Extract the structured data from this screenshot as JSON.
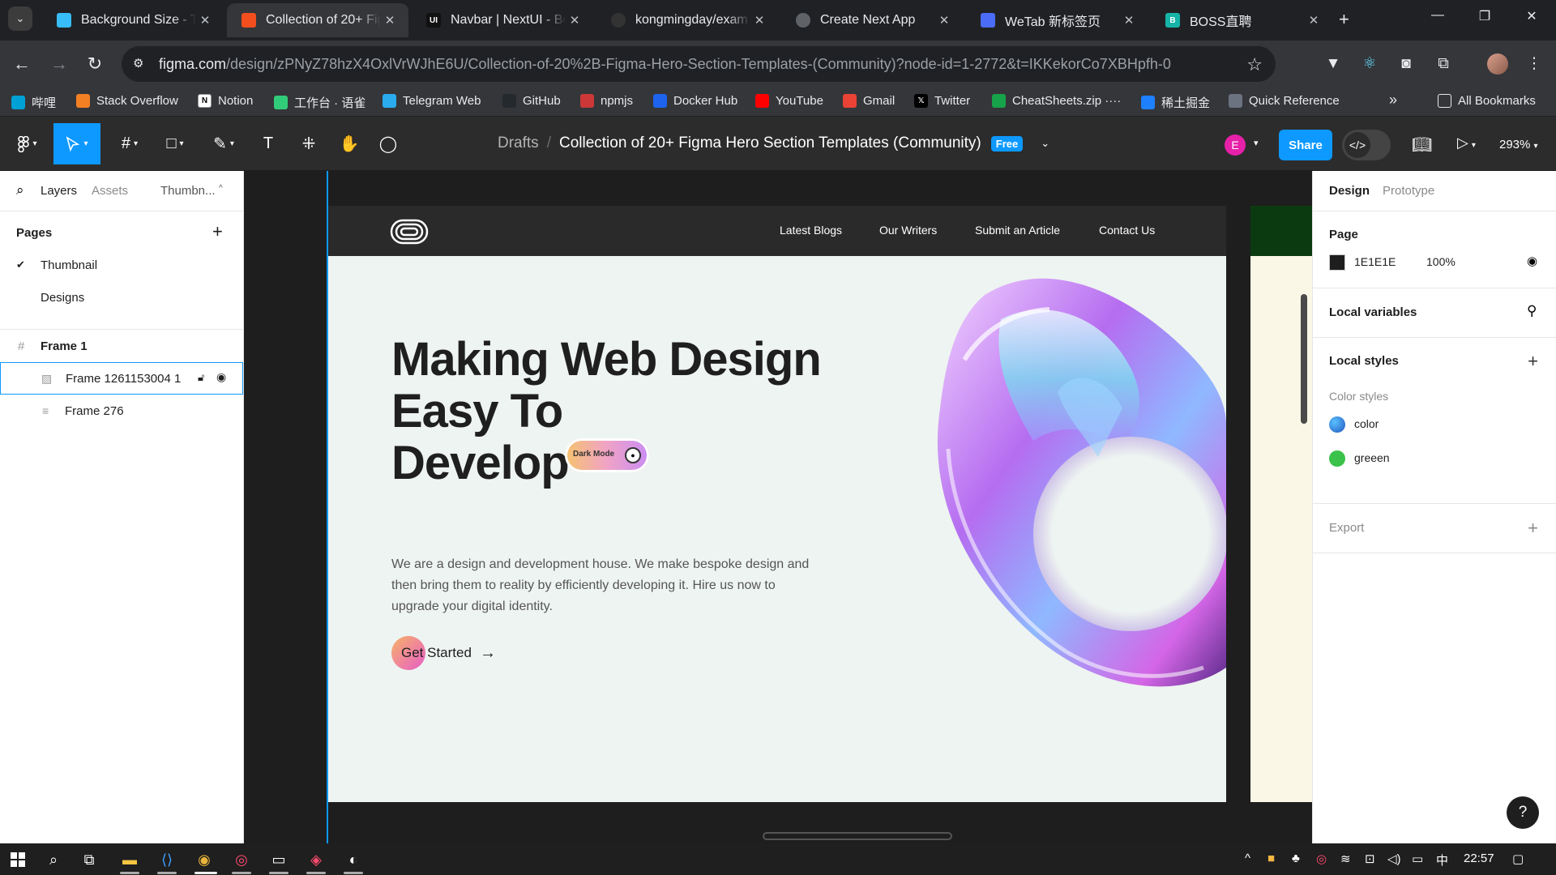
{
  "browser": {
    "tabs": [
      {
        "title": "Background Size - T",
        "icon": "tailwind-icon",
        "color": "#38bdf8",
        "active": false
      },
      {
        "title": "Collection of 20+ Fig",
        "icon": "figma-icon",
        "color": "#f24e1e",
        "active": true
      },
      {
        "title": "Navbar | NextUI - Be",
        "icon": "nextui-icon",
        "color": "#111111",
        "active": false
      },
      {
        "title": "kongmingday/exam",
        "icon": "github-icon",
        "color": "#333333",
        "active": false
      },
      {
        "title": "Create Next App",
        "icon": "globe-icon",
        "color": "#5f6368",
        "active": false
      },
      {
        "title": "WeTab 新标签页",
        "icon": "wetab-icon",
        "color": "#4a6cf7",
        "active": false
      },
      {
        "title": "BOSS直聘",
        "icon": "boss-icon",
        "color": "#15b3a8",
        "active": false
      }
    ],
    "tab_icon_letters": {
      "ui": "UI",
      "boss": "B"
    },
    "url_host": "figma.com",
    "url_path": "/design/zPNyZ78hzX4OxlVrWJhE6U/Collection-of-20%2B-Figma-Hero-Section-Templates-(Community)?node-id=1-2772&t=IKKekorCo7XBHpfh-0"
  },
  "bookmarks": [
    {
      "label": "哔哩",
      "icon": "bilibili-icon",
      "color": "#00a1d6"
    },
    {
      "label": "Stack Overflow",
      "icon": "stackoverflow-icon",
      "color": "#f48024"
    },
    {
      "label": "Notion",
      "icon": "notion-icon",
      "color": "#ffffff"
    },
    {
      "label": "工作台 · 语雀",
      "icon": "yuque-icon",
      "color": "#31cc79"
    },
    {
      "label": "Telegram Web",
      "icon": "telegram-icon",
      "color": "#2aabee"
    },
    {
      "label": "GitHub",
      "icon": "github-icon",
      "color": "#24292e"
    },
    {
      "label": "npmjs",
      "icon": "npm-icon",
      "color": "#cb3837"
    },
    {
      "label": "Docker Hub",
      "icon": "docker-icon",
      "color": "#1d63ed"
    },
    {
      "label": "YouTube",
      "icon": "youtube-icon",
      "color": "#ff0000"
    },
    {
      "label": "Gmail",
      "icon": "gmail-icon",
      "color": "#ea4335"
    },
    {
      "label": "Twitter",
      "icon": "x-icon",
      "color": "#000000"
    },
    {
      "label": "CheatSheets.zip ····",
      "icon": "cheatsheets-icon",
      "color": "#16a34a"
    },
    {
      "label": "稀土掘金",
      "icon": "juejin-icon",
      "color": "#1e80ff"
    },
    {
      "label": "Quick Reference",
      "icon": "quickref-icon",
      "color": "#6b7280"
    }
  ],
  "bookmarks_overflow": "»",
  "all_bookmarks": "All Bookmarks",
  "figma": {
    "breadcrumb_parent": "Drafts",
    "file_name": "Collection of 20+ Figma Hero Section Templates (Community)",
    "plan_badge": "Free",
    "user_initial": "E",
    "share_label": "Share",
    "zoom": "293%"
  },
  "left_panel": {
    "tabs": [
      "Layers",
      "Assets",
      "Thumbn..."
    ],
    "pages_title": "Pages",
    "pages": [
      "Thumbnail",
      "Designs"
    ],
    "layers": [
      {
        "name": "Frame 1",
        "level": 0
      },
      {
        "name": "Frame 1261153004 1",
        "level": 1,
        "selected": true
      },
      {
        "name": "Frame 276",
        "level": 1
      }
    ]
  },
  "site": {
    "nav": [
      "Latest Blogs",
      "Our Writers",
      "Submit an Article",
      "Contact Us"
    ],
    "title_lines": [
      "Making Web Design",
      "Easy To",
      "Develop"
    ],
    "pill_label": "Dark Mode",
    "paragraph": "We are a design and development house. We make bespoke design and then bring them to reality by efficiently developing it. Hire us now to upgrade your digital identity.",
    "cta": "Get Started"
  },
  "right_panel": {
    "tabs": [
      "Design",
      "Prototype"
    ],
    "page_title": "Page",
    "page_color": "1E1E1E",
    "page_opacity": "100%",
    "local_variables": "Local variables",
    "local_styles": "Local styles",
    "color_styles_title": "Color styles",
    "color_styles": [
      {
        "name": "color",
        "color": "#1f7ae0"
      },
      {
        "name": "greeen",
        "color": "#3ac24a"
      }
    ],
    "export": "Export"
  },
  "taskbar": {
    "time": "22:57",
    "ime": "中"
  },
  "colors": {
    "figma_blue": "#0d99ff",
    "canvas_bg": "#1e1e1e",
    "hero_bg": "#eef4f1"
  }
}
